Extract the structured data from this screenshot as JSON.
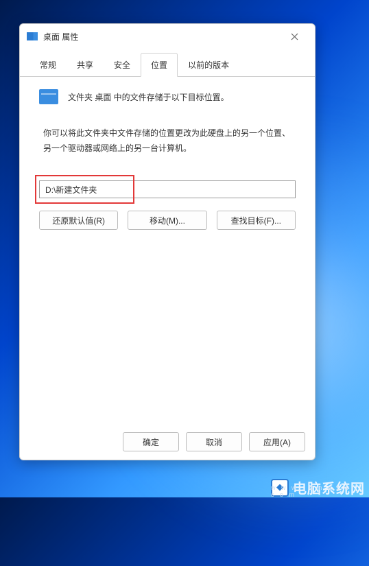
{
  "titlebar": {
    "title": "桌面 属性"
  },
  "tabs": {
    "general": "常规",
    "share": "共享",
    "security": "安全",
    "location": "位置",
    "previous": "以前的版本"
  },
  "content": {
    "folder_line": "文件夹 桌面 中的文件存储于以下目标位置。",
    "description": "你可以将此文件夹中文件存储的位置更改为此硬盘上的另一个位置、另一个驱动器或网络上的另一台计算机。",
    "path_value": "D:\\新建文件夹"
  },
  "buttons": {
    "restore": "还原默认值(R)",
    "move": "移动(M)...",
    "find": "查找目标(F)...",
    "ok": "确定",
    "cancel": "取消",
    "apply": "应用(A)"
  },
  "watermark": {
    "cn": "电脑系统网",
    "en": "w w w . d n x t w . c o m"
  }
}
